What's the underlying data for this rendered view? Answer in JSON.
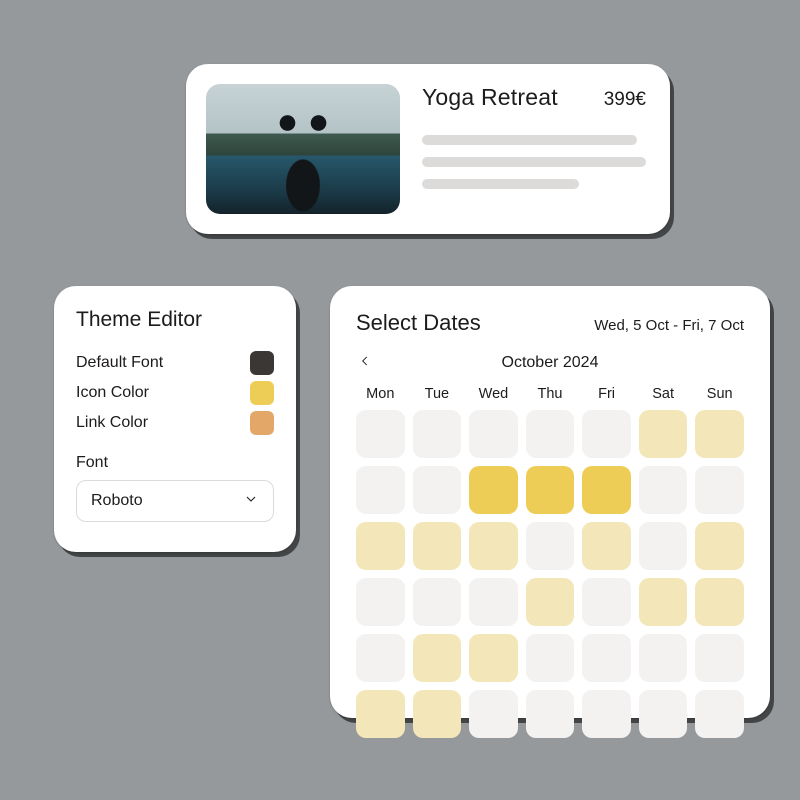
{
  "product": {
    "title": "Yoga Retreat",
    "price": "399€",
    "image_alt": "person-doing-yoga-in-infinity-pool"
  },
  "theme": {
    "title": "Theme Editor",
    "rows": [
      {
        "label": "Default Font",
        "color": "#3a3735"
      },
      {
        "label": "Icon Color",
        "color": "#eecd57"
      },
      {
        "label": "Link Color",
        "color": "#e3a868"
      }
    ],
    "font_label": "Font",
    "font_value": "Roboto"
  },
  "dates": {
    "title": "Select Dates",
    "range": "Wed, 5 Oct - Fri, 7 Oct",
    "month": "October 2024",
    "weekdays": [
      "Mon",
      "Tue",
      "Wed",
      "Thu",
      "Fri",
      "Sat",
      "Sun"
    ],
    "grid": [
      [
        "unavail",
        "unavail",
        "unavail",
        "unavail",
        "unavail",
        "avail",
        "avail"
      ],
      [
        "unavail",
        "unavail",
        "selected",
        "selected",
        "selected",
        "unavail",
        "unavail"
      ],
      [
        "avail",
        "avail",
        "avail",
        "unavail",
        "avail",
        "unavail",
        "avail"
      ],
      [
        "unavail",
        "unavail",
        "unavail",
        "avail",
        "unavail",
        "avail",
        "avail"
      ],
      [
        "unavail",
        "avail",
        "avail",
        "unavail",
        "unavail",
        "unavail",
        "unavail"
      ],
      [
        "avail",
        "avail",
        "unavail",
        "unavail",
        "unavail",
        "unavail",
        "unavail"
      ]
    ]
  }
}
